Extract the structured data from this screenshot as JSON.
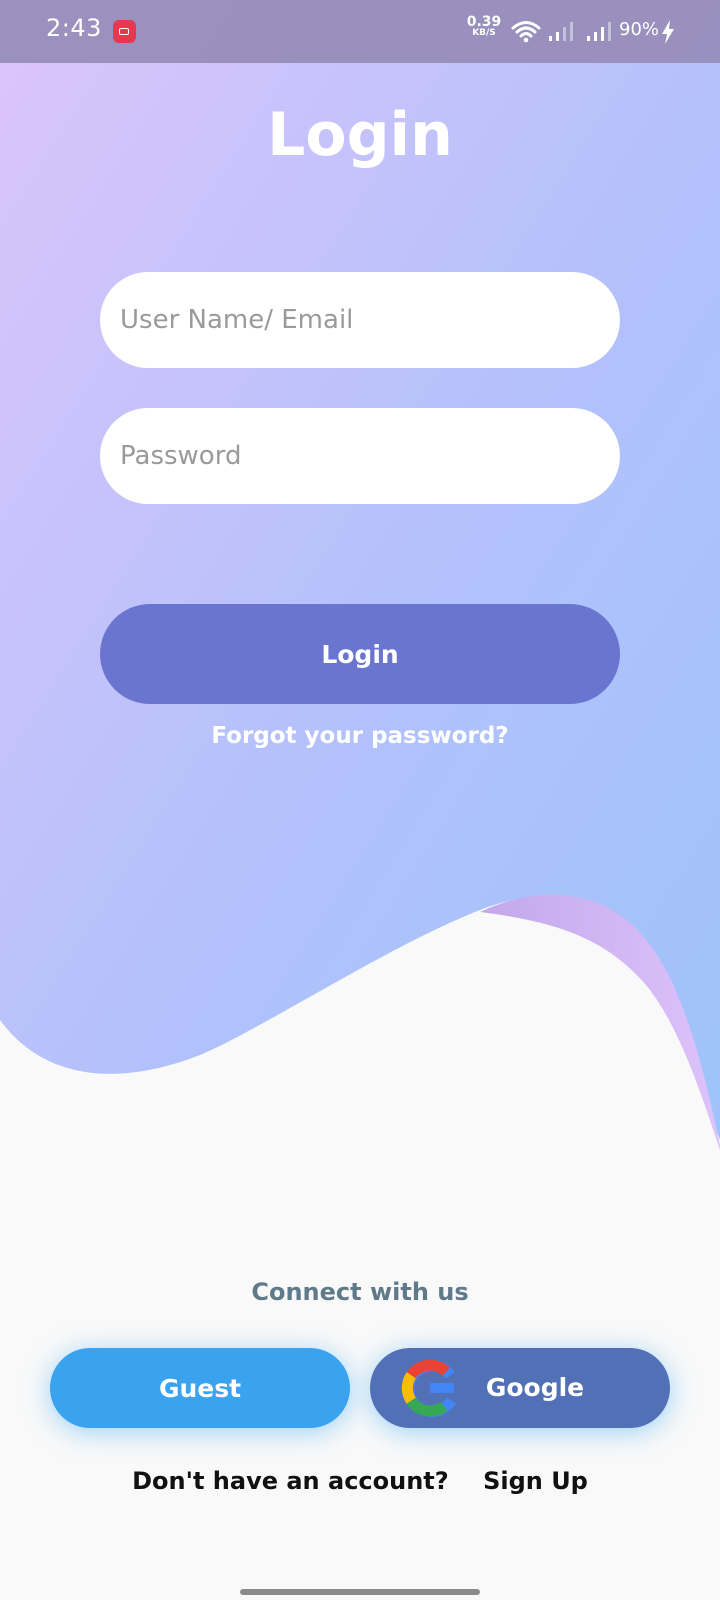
{
  "status_bar": {
    "time": "2:43",
    "net_speed_value": "0.39",
    "net_speed_unit": "KB/S",
    "battery": "90%",
    "icons": [
      "screen-record-icon",
      "wifi-icon",
      "signal-icon",
      "signal-icon",
      "charging-icon"
    ]
  },
  "login": {
    "title": "Login",
    "username_placeholder": "User Name/ Email",
    "password_placeholder": "Password",
    "button_label": "Login",
    "forgot_label": "Forgot your password?"
  },
  "social": {
    "connect_label": "Connect with us",
    "guest_label": "Guest",
    "google_label": "Google"
  },
  "signup": {
    "prompt": "Don't have an account?",
    "link_label": "Sign Up"
  },
  "colors": {
    "gradient_top": "#dcc4fb",
    "gradient_bottom": "#a3c2fb",
    "login_button": "#6a75cf",
    "guest_button": "#3aa3ef",
    "google_button": "#5170b6",
    "connect_text": "#5f7b89"
  }
}
